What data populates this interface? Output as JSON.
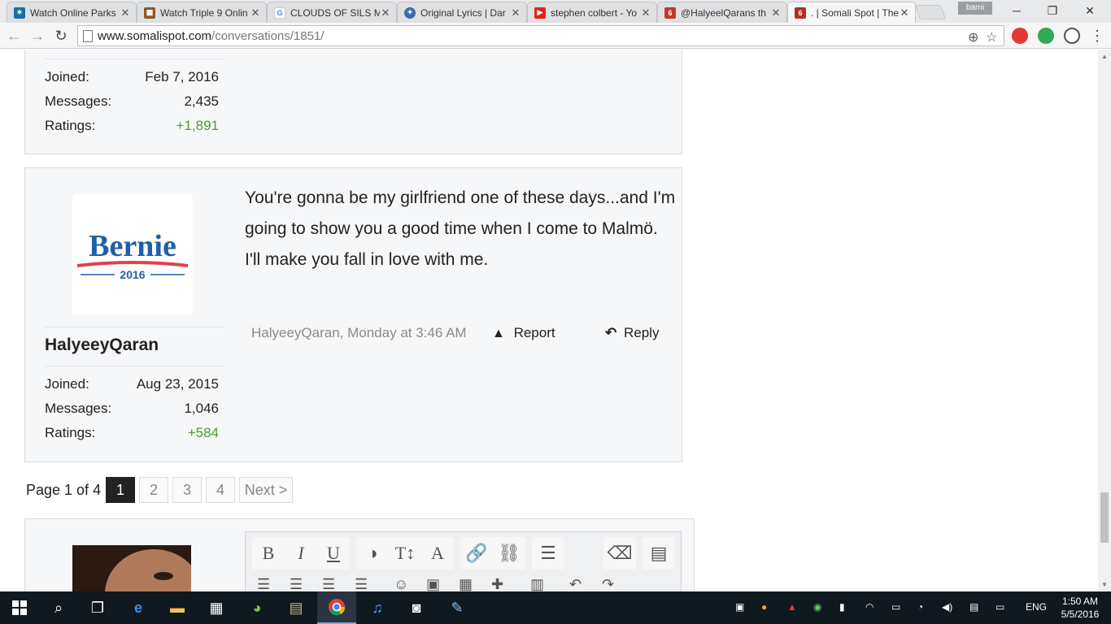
{
  "browser": {
    "tabs": [
      {
        "title": "Watch Online Parks",
        "icon_color": "#1a6fa8"
      },
      {
        "title": "Watch Triple 9 Onlin",
        "icon_color": "#8a5a2b"
      },
      {
        "title": "CLOUDS OF SILS M",
        "icon_color": "#4285f4"
      },
      {
        "title": "Original Lyrics | Dar",
        "icon_color": "#3c6ab0"
      },
      {
        "title": "stephen colbert - Yo",
        "icon_color": "#e62117"
      },
      {
        "title": "@HalyeelQarans th",
        "icon_color": "#c0392b"
      },
      {
        "title": ". | Somali Spot | The",
        "icon_color": "#b03020"
      }
    ],
    "profile_name": "barni",
    "url_host": "www.somalispot.com",
    "url_path": "/conversations/1851/"
  },
  "prev_post": {
    "stats": {
      "joined_label": "Joined:",
      "joined": "Feb 7, 2016",
      "messages_label": "Messages:",
      "messages": "2,435",
      "ratings_label": "Ratings:",
      "ratings": "+1,891"
    }
  },
  "post": {
    "avatar": {
      "name": "Bernie",
      "year": "2016",
      "primary": "#1f5fa8",
      "accent": "#e0414b"
    },
    "username": "HalyeeyQaran",
    "stats": {
      "joined_label": "Joined:",
      "joined": "Aug 23, 2015",
      "messages_label": "Messages:",
      "messages": "1,046",
      "ratings_label": "Ratings:",
      "ratings": "+584"
    },
    "message": "You're gonna be my girlfriend one of these days...and I'm going to show you a good time when I come to Malmö. I'll make you fall in love with me.",
    "meta": {
      "author_time": "HalyeeyQaran, Monday at 3:46 AM",
      "report": "Report",
      "reply": "Reply"
    }
  },
  "pagination": {
    "label": "Page 1 of 4",
    "pages": [
      "1",
      "2",
      "3",
      "4"
    ],
    "current": "1",
    "next": "Next >"
  },
  "editor": {
    "buttons": [
      "B",
      "I",
      "U"
    ]
  },
  "taskbar": {
    "language": "ENG",
    "time": "1:50 AM",
    "date": "5/5/2016"
  }
}
